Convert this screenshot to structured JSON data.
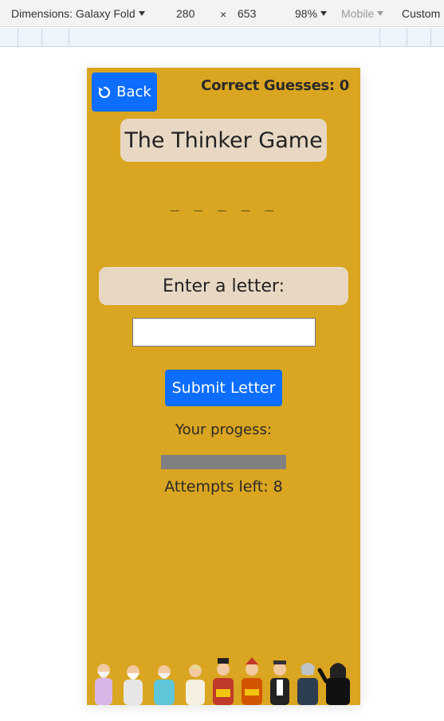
{
  "devtools": {
    "dimensions_label": "Dimensions: Galaxy Fold",
    "width": "280",
    "times": "×",
    "height": "653",
    "zoom": "98%",
    "device_type": "Mobile",
    "custom_label": "Custom"
  },
  "game": {
    "back_label": "Back",
    "score_label": "Correct Guesses: 0",
    "title": "The Thinker Game",
    "word_display": "_ _ _ _ _",
    "prompt": "Enter a letter:",
    "input_value": "",
    "submit_label": "Submit Letter",
    "progress_label": "Your progess:",
    "progress_value": 0,
    "attempts_label": "Attempts left: 8"
  },
  "colors": {
    "background": "#daa520",
    "button": "#0d6efd",
    "panel": "#e8d8c3",
    "progress_track": "#808080"
  },
  "icons": {
    "back": "undo-arrow-icon",
    "footer": "philosophers-illustration"
  }
}
